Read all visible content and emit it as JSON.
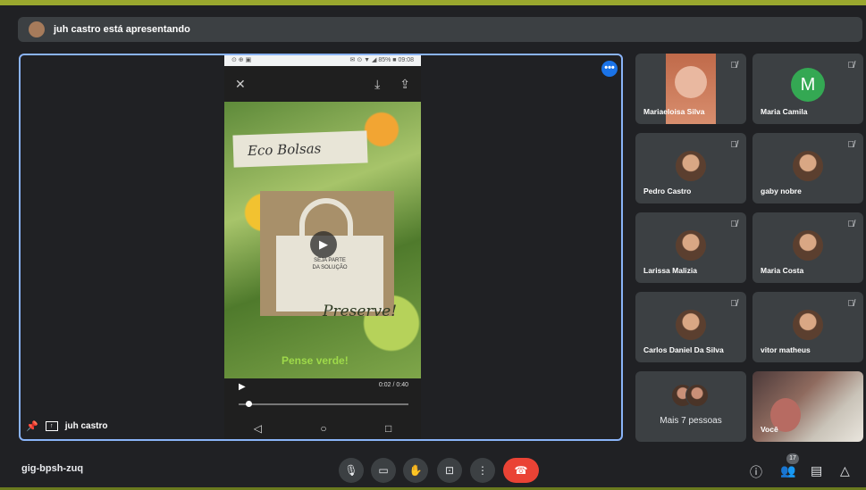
{
  "presenting_banner": "juh castro está apresentando",
  "stage": {
    "presenter_name": "juh castro",
    "more_label": "•••",
    "phone": {
      "status_left": "⊙ ⊕ ▣",
      "status_right": "✉ ⊙ ▼ ◢ 85% ■ 09:08",
      "close_icon": "✕",
      "download_icon": "⤓",
      "share_icon": "⇪",
      "eco_title": "Eco Bolsas",
      "bag_text_1": "SEJA PARTE",
      "bag_text_2": "DA SOLUÇÃO",
      "preserve_text": "Preserve!",
      "pense_text": "Pense verde!",
      "time": "0:02 / 0:40"
    }
  },
  "participants": [
    {
      "name": "Mariaeloisa Silva",
      "type": "video"
    },
    {
      "name": "Maria Camila",
      "type": "letter",
      "letter": "M"
    },
    {
      "name": "Pedro Castro",
      "type": "avatar"
    },
    {
      "name": "gaby nobre",
      "type": "avatar"
    },
    {
      "name": "Larissa Malizia",
      "type": "avatar"
    },
    {
      "name": "Maria Costa",
      "type": "avatar"
    },
    {
      "name": "Carlos Daniel Da Silva",
      "type": "avatar"
    },
    {
      "name": "vitor matheus",
      "type": "avatar"
    },
    {
      "name": "Mais 7 pessoas",
      "type": "more"
    },
    {
      "name": "Você",
      "type": "self"
    }
  ],
  "bottom_bar": {
    "meeting_code": "gig-bpsh-zuq",
    "participants_count": "17"
  },
  "colors": {
    "accent": "#8ab4f8",
    "end_call": "#ea4335",
    "avatar_m": "#34a853"
  }
}
